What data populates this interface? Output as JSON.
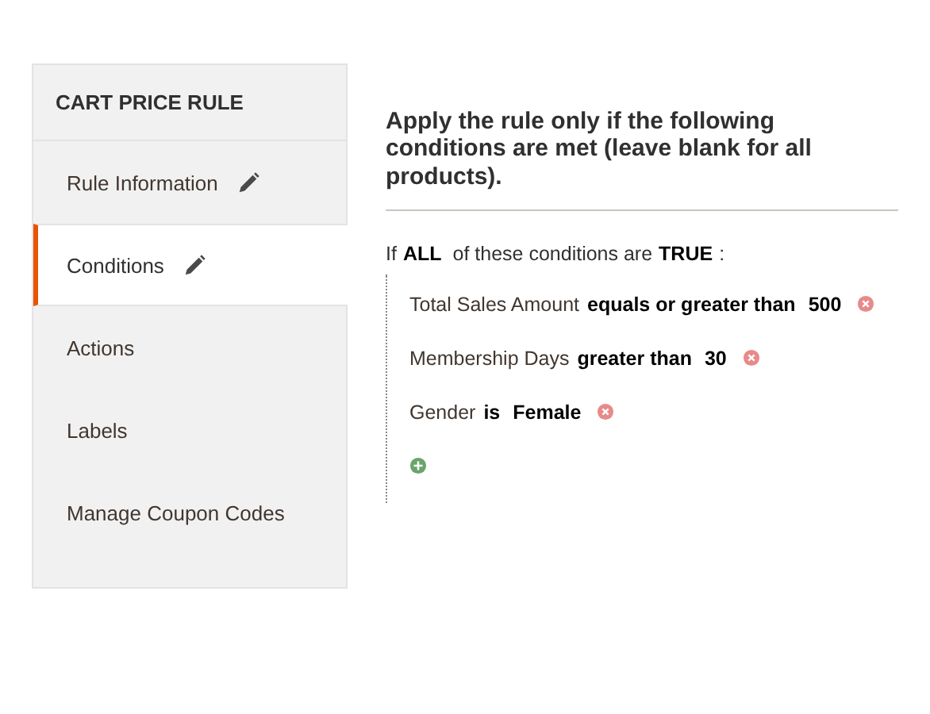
{
  "sidebar": {
    "title": "CART PRICE RULE",
    "items": [
      {
        "label": "Rule Information",
        "selected": false,
        "edited": true
      },
      {
        "label": "Conditions",
        "selected": true,
        "edited": true
      },
      {
        "label": "Actions",
        "selected": false,
        "edited": false
      },
      {
        "label": "Labels",
        "selected": false,
        "edited": false
      },
      {
        "label": "Manage Coupon Codes",
        "selected": false,
        "edited": false
      }
    ]
  },
  "content": {
    "heading": "Apply the rule only if the following conditions are met (leave blank for all products).",
    "rule": {
      "prefix": "If",
      "aggregator": "ALL",
      "middle": "of these conditions are",
      "value": "TRUE",
      "suffix": ":"
    },
    "conditions": [
      {
        "attribute": "Total Sales Amount",
        "operator": "equals or greater than",
        "value": "500"
      },
      {
        "attribute": "Membership Days",
        "operator": "greater than",
        "value": "30"
      },
      {
        "attribute": "Gender",
        "operator": "is",
        "value": "Female"
      }
    ]
  }
}
